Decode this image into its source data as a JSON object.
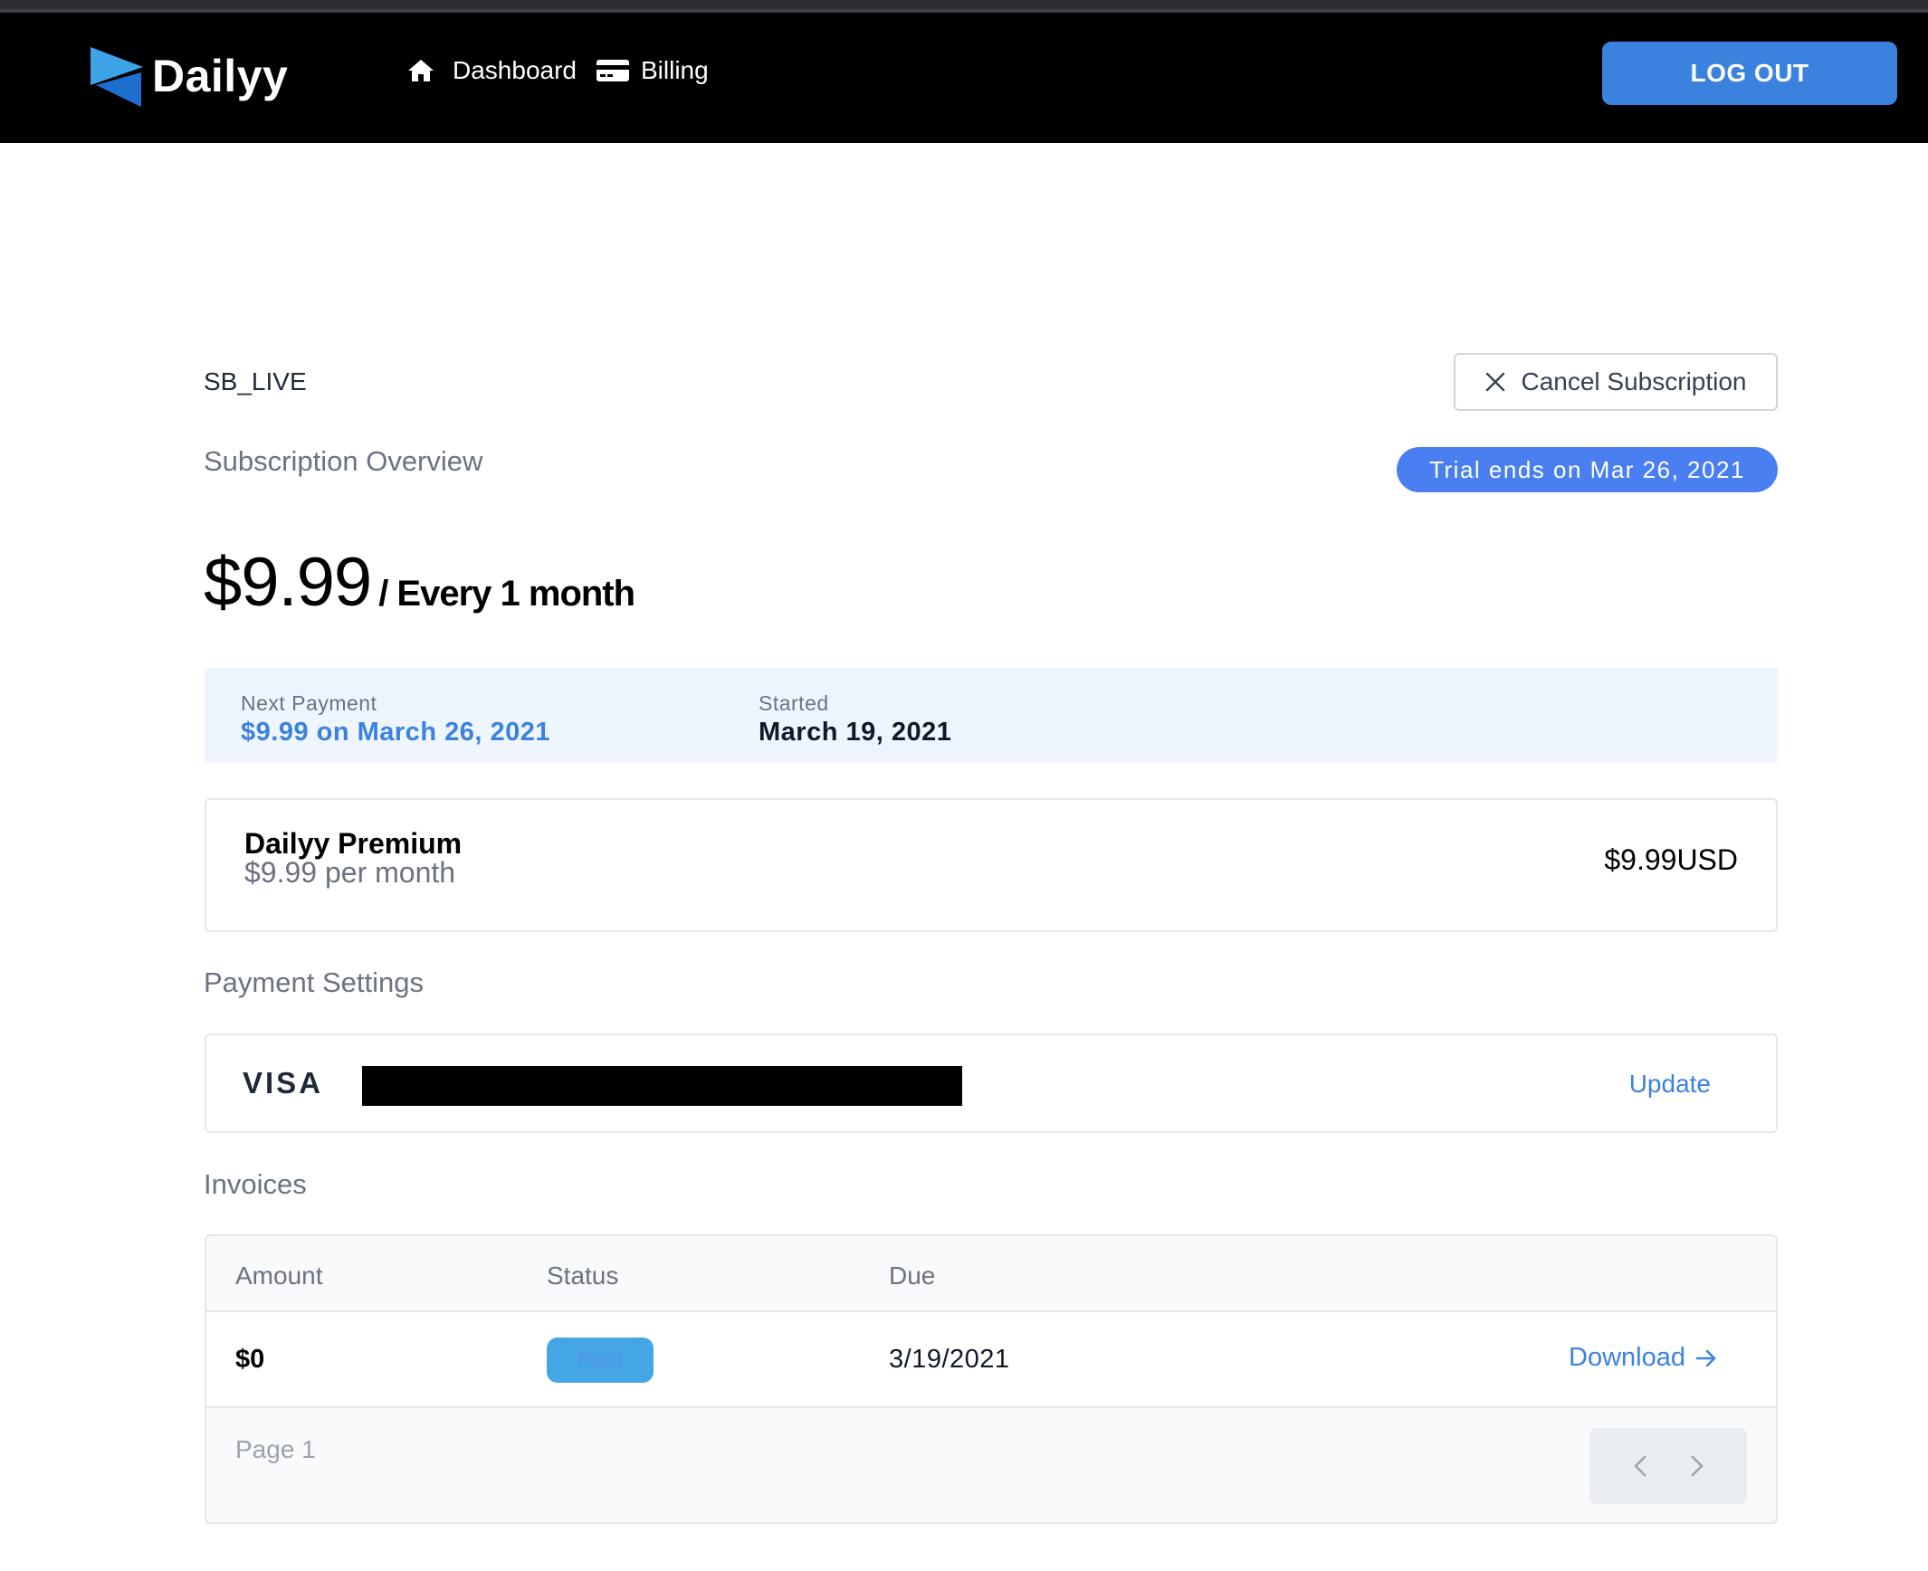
{
  "app": {
    "name": "Dailyy",
    "brand_colors": {
      "logo_light": "#3fa3e8",
      "logo_dark": "#1f6fd0",
      "accent": "#3b82df",
      "badge": "#4a7ff2"
    }
  },
  "nav": {
    "links": [
      {
        "label": "Dashboard",
        "icon": "home-icon"
      },
      {
        "label": "Billing",
        "icon": "credit-card-icon"
      }
    ],
    "logout_label": "LOG OUT"
  },
  "subscription": {
    "account_id": "SB_LIVE",
    "cancel_label": "Cancel Subscription",
    "overview_title": "Subscription Overview",
    "trial_badge": "Trial ends on Mar 26, 2021",
    "price": "$9.99",
    "period": "/ Every 1 month",
    "next_payment_label": "Next Payment",
    "next_payment_value": "$9.99 on March 26, 2021",
    "started_label": "Started",
    "started_value": "March 19, 2021"
  },
  "plan": {
    "name": "Dailyy Premium",
    "subtitle": "$9.99 per month",
    "price": "$9.99USD"
  },
  "payment": {
    "section_title": "Payment Settings",
    "card_brand": "VISA",
    "update_label": "Update"
  },
  "invoices": {
    "section_title": "Invoices",
    "columns": [
      "Amount",
      "Status",
      "Due"
    ],
    "rows": [
      {
        "amount": "$0",
        "status": "Paid",
        "due": "3/19/2021",
        "action": "Download"
      }
    ],
    "page_label": "Page 1"
  }
}
